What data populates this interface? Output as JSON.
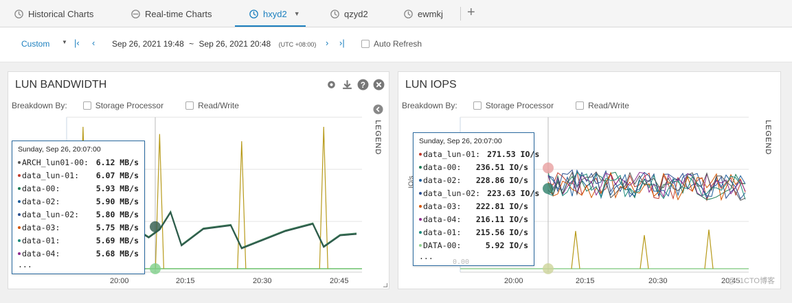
{
  "tabs": [
    {
      "label": "Historical Charts",
      "icon": "chart-clock-icon"
    },
    {
      "label": "Real-time Charts",
      "icon": "realtime-icon"
    },
    {
      "label": "hxyd2",
      "icon": "chart-clock-icon",
      "active": true
    },
    {
      "label": "qzyd2",
      "icon": "chart-clock-icon"
    },
    {
      "label": "ewmkj",
      "icon": "chart-clock-icon"
    }
  ],
  "toolbar": {
    "range_preset": "Custom",
    "range_start": "Sep 26, 2021 19:48",
    "range_sep": "~",
    "range_end": "Sep 26, 2021 20:48",
    "timezone": "(UTC +08:00)",
    "auto_refresh_label": "Auto Refresh"
  },
  "colors": {
    "accent": "#1b7fbf",
    "line_dark": "#2e5a4b",
    "line_green": "#8fd08f",
    "line_olive": "#b79a1a"
  },
  "panels": [
    {
      "title": "LUN BANDWIDTH",
      "breakdown_label": "Breakdown By:",
      "opt_sp": "Storage Processor",
      "opt_rw": "Read/Write",
      "legend_label": "LEGEND",
      "xticks": [
        "20:00",
        "20:15",
        "20:30",
        "20:45"
      ],
      "tooltip": {
        "header": "Sunday, Sep 26, 20:07:00",
        "rows": [
          {
            "name": "ARCH_lun01-00:",
            "value": "6.12 MB/s",
            "color": "#555555"
          },
          {
            "name": "data_lun-01:",
            "value": "6.07 MB/s",
            "color": "#c0392b"
          },
          {
            "name": "data-00:",
            "value": "5.93 MB/s",
            "color": "#1a7a55"
          },
          {
            "name": "data-02:",
            "value": "5.90 MB/s",
            "color": "#1b5c9a"
          },
          {
            "name": "data_lun-02:",
            "value": "5.80 MB/s",
            "color": "#2b4f8f"
          },
          {
            "name": "data-03:",
            "value": "5.75 MB/s",
            "color": "#d35400"
          },
          {
            "name": "data-01:",
            "value": "5.69 MB/s",
            "color": "#1a8a7a"
          },
          {
            "name": "data-04:",
            "value": "5.68 MB/s",
            "color": "#8e2b8e"
          }
        ],
        "more": "..."
      },
      "chart_data": {
        "type": "line",
        "x": [
          "19:55",
          "20:00",
          "20:05",
          "20:07",
          "20:10",
          "20:12",
          "20:14",
          "20:16",
          "20:20",
          "20:25",
          "20:27",
          "20:30",
          "20:35",
          "20:40",
          "20:42",
          "20:45",
          "20:48"
        ],
        "series": [
          {
            "name": "ARCH_lun01-00",
            "values": [
              3.5,
              4.5,
              5.5,
              6.12,
              4.7,
              5.8,
              8.2,
              3.6,
              5.9,
              6.4,
              3.2,
              4.1,
              5.6,
              6.6,
              3.4,
              5.0,
              5.2
            ]
          },
          {
            "name": "data_lun-01",
            "values": [
              3.4,
              4.4,
              5.4,
              6.07,
              4.6,
              5.7,
              8.1,
              3.5,
              5.8,
              6.3,
              3.1,
              4.0,
              5.5,
              6.5,
              3.3,
              4.9,
              5.1
            ]
          }
        ],
        "spikes": {
          "name": "olive",
          "x": [
            "19:58",
            "20:12",
            "20:27",
            "20:42"
          ],
          "values": [
            20,
            19,
            18,
            20
          ]
        }
      }
    },
    {
      "title": "LUN IOPS",
      "breakdown_label": "Breakdown By:",
      "opt_sp": "Storage Processor",
      "opt_rw": "Read/Write",
      "legend_label": "LEGEND",
      "ylabel": "IO/s",
      "xticks": [
        "20:00",
        "20:15",
        "20:30",
        "20:45"
      ],
      "tooltip": {
        "header": "Sunday, Sep 26, 20:07:00",
        "rows": [
          {
            "name": "data_lun-01:",
            "value": "271.53 IO/s",
            "color": "#c0392b"
          },
          {
            "name": "data-00:",
            "value": "236.51 IO/s",
            "color": "#1a7a55"
          },
          {
            "name": "data-02:",
            "value": "228.86 IO/s",
            "color": "#1b5c9a"
          },
          {
            "name": "data_lun-02:",
            "value": "223.63 IO/s",
            "color": "#2b4f8f"
          },
          {
            "name": "data-03:",
            "value": "222.81 IO/s",
            "color": "#d35400"
          },
          {
            "name": "data-04:",
            "value": "216.11 IO/s",
            "color": "#8e2b8e"
          },
          {
            "name": "data-01:",
            "value": "215.56 IO/s",
            "color": "#1a8a7a"
          },
          {
            "name": "DATA-00:",
            "value": "5.92 IO/s",
            "color": "#8fd08f"
          }
        ],
        "more": "...",
        "yzero": "0.00"
      }
    }
  ],
  "watermark": "@51CTO博客"
}
